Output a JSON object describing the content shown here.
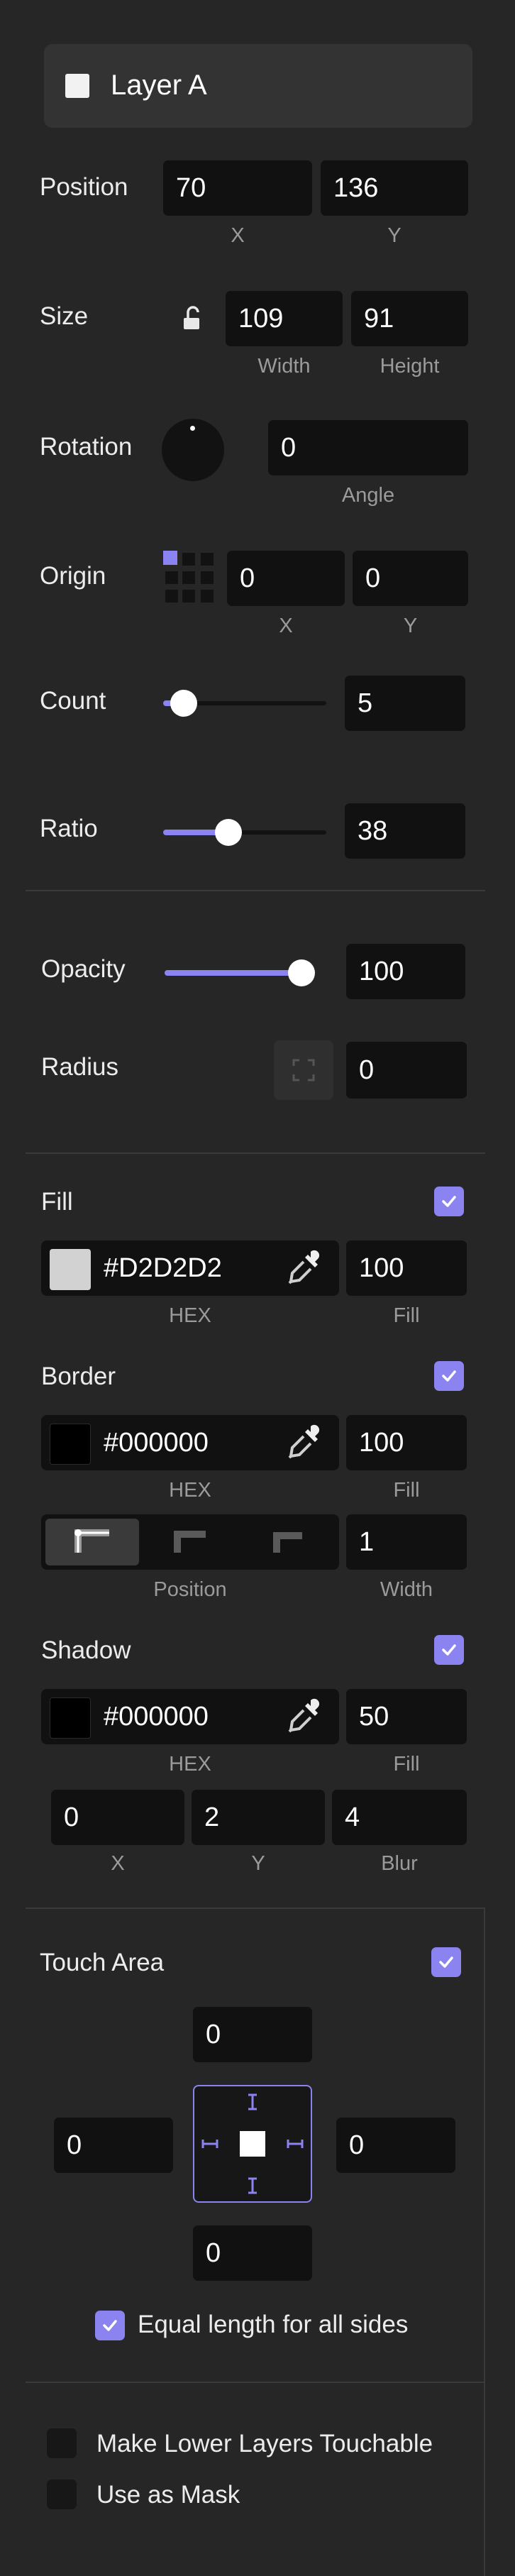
{
  "layer": {
    "name": "Layer A"
  },
  "position": {
    "label": "Position",
    "x": "70",
    "y": "136",
    "x_caption": "X",
    "y_caption": "Y"
  },
  "size": {
    "label": "Size",
    "width": "109",
    "height": "91",
    "width_caption": "Width",
    "height_caption": "Height",
    "lock_icon": "unlock-icon"
  },
  "rotation": {
    "label": "Rotation",
    "angle": "0",
    "angle_caption": "Angle"
  },
  "origin": {
    "label": "Origin",
    "x": "0",
    "y": "0",
    "x_caption": "X",
    "y_caption": "Y"
  },
  "count": {
    "label": "Count",
    "value": "5",
    "slider_fraction": 0.05
  },
  "ratio": {
    "label": "Ratio",
    "value": "38",
    "slider_fraction": 0.38
  },
  "opacity": {
    "label": "Opacity",
    "value": "100",
    "slider_fraction": 1.0
  },
  "radius": {
    "label": "Radius",
    "value": "0"
  },
  "fill": {
    "label": "Fill",
    "hex": "#D2D2D2",
    "amount": "100",
    "hex_caption": "HEX",
    "amount_caption": "Fill",
    "color": "#D2D2D2",
    "enabled": true
  },
  "border": {
    "label": "Border",
    "hex": "#000000",
    "amount": "100",
    "hex_caption": "HEX",
    "amount_caption": "Fill",
    "color": "#000000",
    "enabled": true,
    "position_caption": "Position",
    "width": "1",
    "width_caption": "Width",
    "position_options": [
      "inside",
      "center",
      "outside"
    ],
    "selected_position": "inside"
  },
  "shadow": {
    "label": "Shadow",
    "hex": "#000000",
    "amount": "50",
    "hex_caption": "HEX",
    "amount_caption": "Fill",
    "color": "#000000",
    "enabled": true,
    "x": "0",
    "y": "2",
    "blur": "4",
    "x_caption": "X",
    "y_caption": "Y",
    "blur_caption": "Blur"
  },
  "touch_area": {
    "label": "Touch Area",
    "enabled": true,
    "top": "0",
    "left": "0",
    "right": "0",
    "bottom": "0",
    "equal_label": "Equal length for all sides",
    "equal_checked": true
  },
  "options": {
    "lower_layers_label": "Make Lower Layers Touchable",
    "lower_layers_checked": false,
    "mask_label": "Use as Mask",
    "mask_checked": false
  },
  "colors": {
    "accent": "#8B83F0",
    "panel": "#262626",
    "field": "#111111"
  }
}
